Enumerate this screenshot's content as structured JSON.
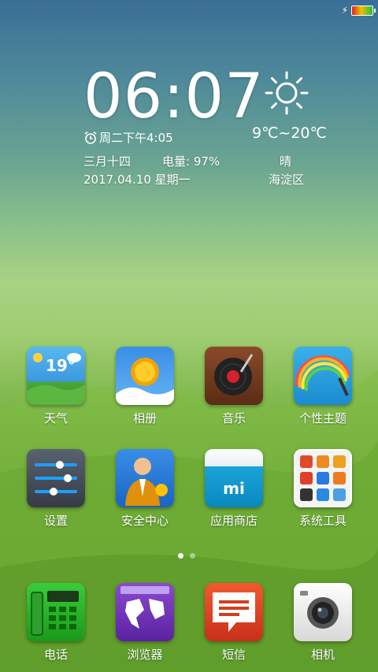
{
  "status": {
    "charging": "⚡"
  },
  "clock": {
    "time": "06:07",
    "alarm": "周二下午4:05",
    "lunar": "三月十四",
    "battery": "电量: 97%",
    "date": "2017.04.10 星期一"
  },
  "weather": {
    "temp": "9℃~20℃",
    "condition": "晴",
    "location": "海淀区",
    "icon": "sun-icon"
  },
  "apps_row1": [
    {
      "label": "天气",
      "icon": "weather-icon",
      "badge": "19°"
    },
    {
      "label": "相册",
      "icon": "gallery-icon"
    },
    {
      "label": "音乐",
      "icon": "music-icon"
    },
    {
      "label": "个性主题",
      "icon": "themes-icon"
    }
  ],
  "apps_row2": [
    {
      "label": "设置",
      "icon": "settings-icon"
    },
    {
      "label": "安全中心",
      "icon": "security-icon"
    },
    {
      "label": "应用商店",
      "icon": "app-store-icon",
      "logo": "mi"
    },
    {
      "label": "系统工具",
      "icon": "system-tools-icon"
    }
  ],
  "dock": [
    {
      "label": "电话",
      "icon": "phone-icon"
    },
    {
      "label": "浏览器",
      "icon": "browser-icon"
    },
    {
      "label": "短信",
      "icon": "messages-icon"
    },
    {
      "label": "相机",
      "icon": "camera-icon"
    }
  ],
  "pager": {
    "pages": 2,
    "current": 1
  }
}
